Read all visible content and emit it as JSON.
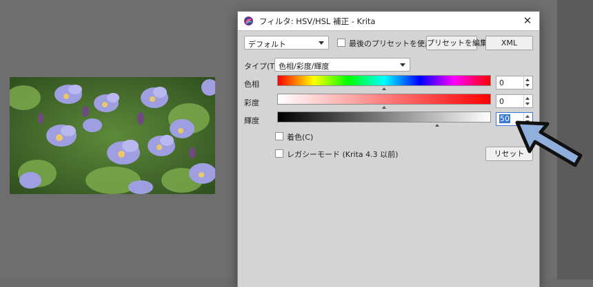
{
  "window": {
    "title": "フィルタ: HSV/HSL 補正 - Krita",
    "close_glyph": "✕"
  },
  "preset": {
    "selected": "デフォルト",
    "use_last_label": "最後のプリセットを使用",
    "edit_button": "プリセットを編集",
    "xml_button": "XML"
  },
  "type": {
    "label": "タイプ(T):",
    "selected": "色相/彩度/輝度"
  },
  "sliders": [
    {
      "label": "色相",
      "value": "0",
      "handle_fraction": 0.5
    },
    {
      "label": "彩度",
      "value": "0",
      "handle_fraction": 0.5
    },
    {
      "label": "輝度",
      "value": "50",
      "handle_fraction": 0.75,
      "selected": true
    }
  ],
  "options": {
    "colorize_label": "着色(C)",
    "legacy_label": "レガシーモード (Krita 4.3 以前)",
    "reset_button": "リセット"
  },
  "colors": {
    "dialog_bg": "#d4d4d4",
    "selection": "#3a78d4",
    "arrow_fill": "#8fb0dc",
    "arrow_stroke": "#111111"
  },
  "icons": [
    "krita-logo-icon",
    "close-icon",
    "chevron-down-icon",
    "spin-up-icon",
    "spin-down-icon",
    "pointer-arrow-icon"
  ]
}
